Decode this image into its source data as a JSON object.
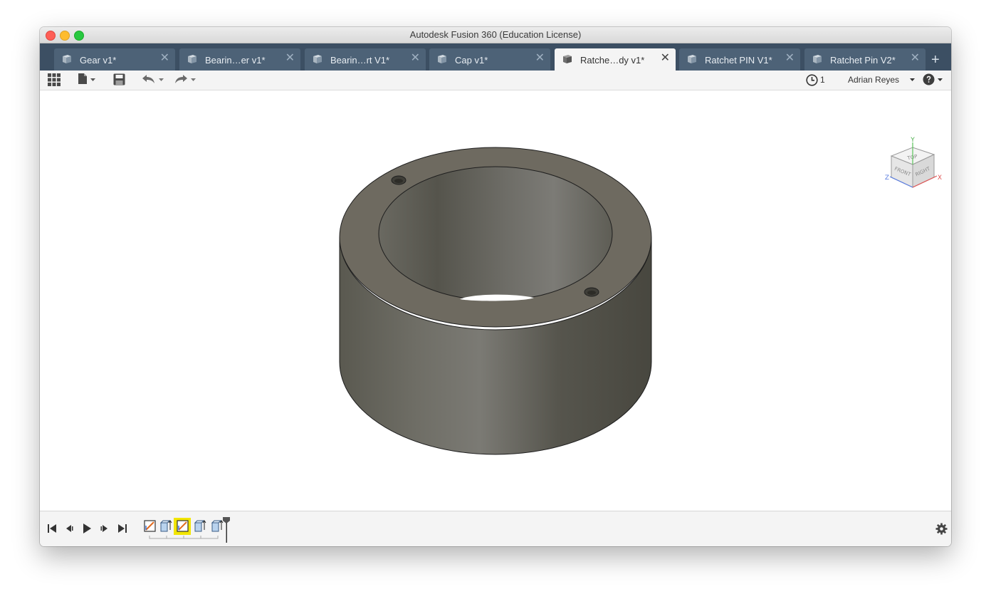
{
  "window": {
    "title": "Autodesk Fusion 360 (Education License)"
  },
  "tabs": [
    {
      "label": "Gear v1*",
      "active": false
    },
    {
      "label": "Bearin…er v1*",
      "active": false
    },
    {
      "label": "Bearin…rt V1*",
      "active": false
    },
    {
      "label": "Cap v1*",
      "active": false
    },
    {
      "label": "Ratche…dy v1*",
      "active": true
    },
    {
      "label": "Ratchet PIN V1*",
      "active": false
    },
    {
      "label": "Ratchet Pin V2*",
      "active": false
    }
  ],
  "tab_close_glyph": "✕",
  "tab_add_glyph": "+",
  "toolbar": {
    "job_status_count": "1",
    "user_name": "Adrian Reyes",
    "icons": [
      "data-panel-grid-icon",
      "file-icon",
      "save-icon",
      "undo-icon",
      "redo-icon",
      "clock-icon",
      "help-icon"
    ]
  },
  "viewcube": {
    "faces": {
      "top": "TOP",
      "front": "FRONT",
      "right": "RIGHT"
    },
    "axes": {
      "x": "X",
      "y": "Y",
      "z": "Z"
    }
  },
  "timeline": {
    "controls": [
      "skip-to-start-icon",
      "step-back-icon",
      "play-icon",
      "step-forward-icon",
      "skip-to-end-icon"
    ],
    "features": [
      "sketch",
      "extrude",
      "sketch",
      "extrude",
      "extrude"
    ],
    "selected_feature_index": 2,
    "marker_after_index": 4
  },
  "colors": {
    "tabbar": "#3c4f63",
    "tab": "#4d6277",
    "active_tab": "#f4f4f4",
    "model_body": "#6b6a63",
    "selection_highlight": "#f2e500"
  }
}
